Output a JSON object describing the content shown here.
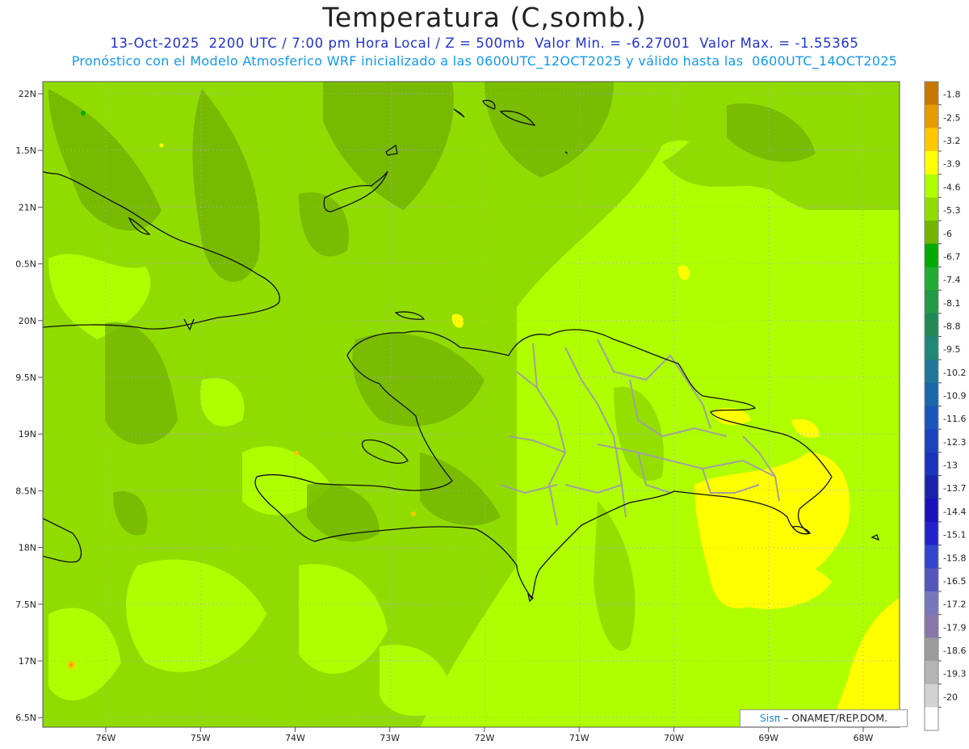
{
  "header": {
    "title": "Temperatura (C,somb.)",
    "line1": "13-Oct-2025  2200 UTC / 7:00 pm Hora Local / Z = 500mb  Valor Min. = -6.27001  Valor Max. = -1.55365",
    "line2": "Pronóstico con el Modelo Atmosferico WRF inicializado a las 0600UTC_12OCT2025 y válido hasta las  0600UTC_14OCT2025"
  },
  "axes": {
    "lat_labels": [
      "22N",
      "1.5N",
      "21N",
      "0.5N",
      "20N",
      "9.5N",
      "19N",
      "8.5N",
      "18N",
      "7.5N",
      "17N",
      "6.5N"
    ],
    "lon_labels": [
      "76W",
      "75W",
      "74W",
      "73W",
      "72W",
      "71W",
      "70W",
      "69W",
      "68W"
    ]
  },
  "legend": {
    "labels": [
      "-1.8",
      "-2.5",
      "-3.2",
      "-3.9",
      "-4.6",
      "-5.3",
      "-6",
      "-6.7",
      "-7.4",
      "-8.1",
      "-8.8",
      "-9.5",
      "-10.2",
      "-10.9",
      "-11.6",
      "-12.3",
      "-13",
      "-13.7",
      "-14.4",
      "-15.1",
      "-15.8",
      "-16.5",
      "-17.2",
      "-17.9",
      "-18.6",
      "-19.3",
      "-20"
    ],
    "colors": [
      "#c87800",
      "#e69b00",
      "#ffc800",
      "#ffff00",
      "#afff00",
      "#91dc00",
      "#73b400",
      "#00aa00",
      "#22aa33",
      "#229944",
      "#228855",
      "#208877",
      "#1e7799",
      "#1a66aa",
      "#1a55bb",
      "#1a44bb",
      "#1a33bb",
      "#1a22aa",
      "#1a11bb",
      "#2222cc",
      "#3344cc",
      "#5555bb",
      "#7777bb",
      "#8877aa",
      "#9c9c9c",
      "#b4b4b4",
      "#d2d2d2",
      "#ffffff"
    ]
  },
  "credit": {
    "sis": "Sisπ",
    "text": "– ONAMET/REP.DOM."
  }
}
